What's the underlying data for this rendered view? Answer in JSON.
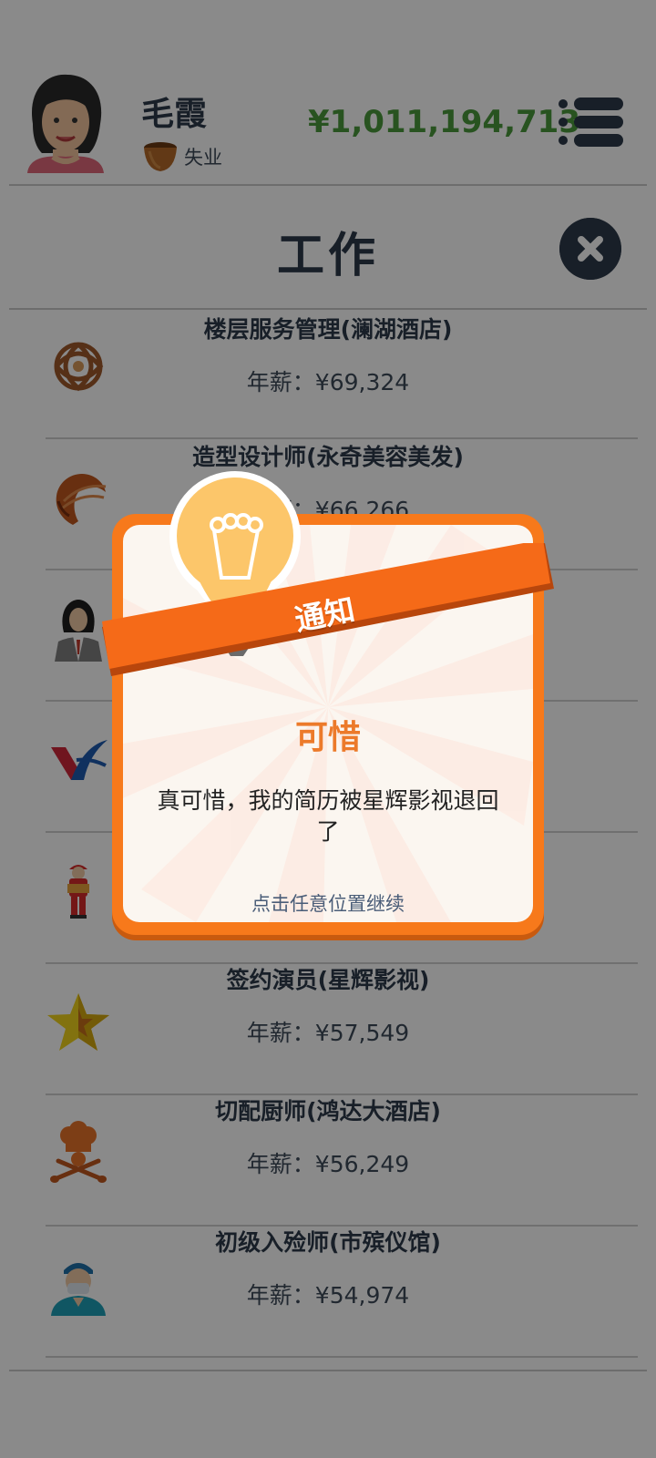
{
  "header": {
    "user_name": "毛霞",
    "status": "失业",
    "balance": "¥1,011,194,713"
  },
  "page_title": "工作",
  "jobs": [
    {
      "title": "楼层服务管理(澜湖酒店)",
      "salary": "年薪：¥69,324",
      "icon": "hotel-knot-icon"
    },
    {
      "title": "造型设计师(永奇美容美发)",
      "salary": "年薪：¥66,266",
      "icon": "hair-salon-icon"
    },
    {
      "title": "",
      "salary": "",
      "icon": "office-woman-icon"
    },
    {
      "title": "",
      "salary": "",
      "icon": "airline-logo-icon"
    },
    {
      "title": "",
      "salary": "",
      "icon": "delivery-worker-icon"
    },
    {
      "title": "签约演员(星辉影视)",
      "salary": "年薪：¥57,549",
      "icon": "star-icon"
    },
    {
      "title": "切配厨师(鸿达大酒店)",
      "salary": "年薪：¥56,249",
      "icon": "chef-icon"
    },
    {
      "title": "初级入殓师(市殡仪馆)",
      "salary": "年薪：¥54,974",
      "icon": "surgeon-icon"
    }
  ],
  "dialog": {
    "ribbon_label": "通知",
    "heading": "可惜",
    "message": "真可惜，我的简历被星辉影视退回了",
    "hint": "点击任意位置继续"
  },
  "colors": {
    "balance": "#4a9a3c",
    "accent": "#f7791b",
    "dark": "#2d3a4a"
  }
}
